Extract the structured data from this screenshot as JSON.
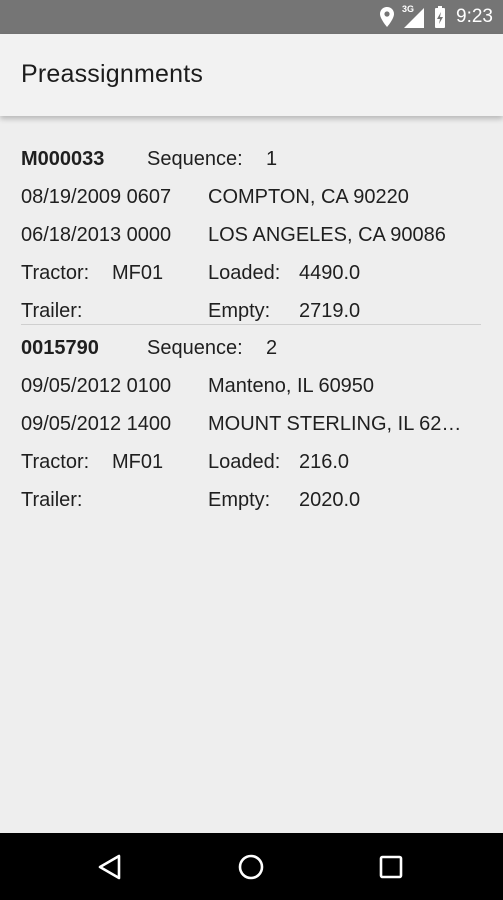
{
  "status_bar": {
    "time": "9:23",
    "network": "3G",
    "icons": [
      "location-icon",
      "signal-icon",
      "battery-icon"
    ]
  },
  "app_bar": {
    "title": "Preassignments"
  },
  "assignments": [
    {
      "id": "M000033",
      "sequence_label": "Sequence:",
      "sequence": "1",
      "stop1_datetime": "08/19/2009 0607",
      "stop1_location": "COMPTON, CA 90220",
      "stop2_datetime": "06/18/2013 0000",
      "stop2_location": "LOS ANGELES, CA 90086",
      "tractor_label": "Tractor:",
      "tractor": "MF01",
      "loaded_label": "Loaded:",
      "loaded": "4490.0",
      "trailer_label": "Trailer:",
      "trailer": "",
      "empty_label": "Empty:",
      "empty": "2719.0"
    },
    {
      "id": "0015790",
      "sequence_label": "Sequence:",
      "sequence": "2",
      "stop1_datetime": "09/05/2012 0100",
      "stop1_location": "Manteno, IL 60950",
      "stop2_datetime": "09/05/2012 1400",
      "stop2_location": "MOUNT STERLING, IL 62…",
      "tractor_label": "Tractor:",
      "tractor": "MF01",
      "loaded_label": "Loaded:",
      "loaded": "216.0",
      "trailer_label": "Trailer:",
      "trailer": "",
      "empty_label": "Empty:",
      "empty": "2020.0"
    }
  ],
  "nav_bar": {
    "buttons": [
      "back-icon",
      "home-icon",
      "recents-icon"
    ]
  }
}
